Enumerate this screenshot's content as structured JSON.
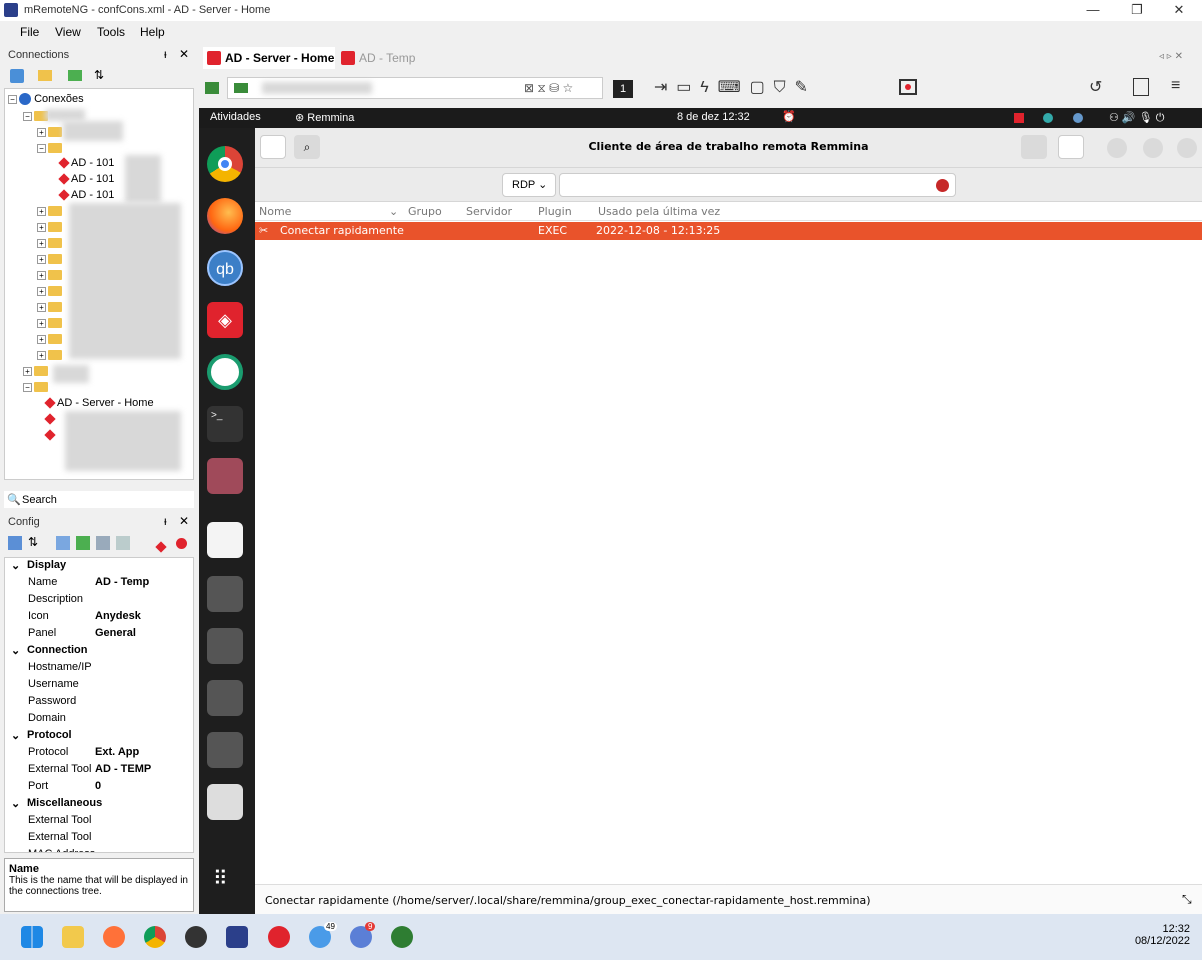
{
  "window": {
    "title": "mRemoteNG - confCons.xml - AD - Server - Home"
  },
  "menu": [
    "File",
    "View",
    "Tools",
    "Help"
  ],
  "connections_panel": {
    "title": "Connections",
    "root": "Conexões",
    "children": [
      "AD - 101",
      "AD - 101",
      "AD - 101"
    ],
    "selected": "AD - Server - Home",
    "search_label": "Search"
  },
  "config_panel": {
    "title": "Config",
    "categories": [
      {
        "name": "Display",
        "props": [
          {
            "k": "Name",
            "v": "AD - Temp"
          },
          {
            "k": "Description",
            "v": ""
          },
          {
            "k": "Icon",
            "v": "Anydesk"
          },
          {
            "k": "Panel",
            "v": "General"
          }
        ]
      },
      {
        "name": "Connection",
        "props": [
          {
            "k": "Hostname/IP",
            "v": ""
          },
          {
            "k": "Username",
            "v": ""
          },
          {
            "k": "Password",
            "v": ""
          },
          {
            "k": "Domain",
            "v": ""
          }
        ]
      },
      {
        "name": "Protocol",
        "props": [
          {
            "k": "Protocol",
            "v": "Ext. App"
          },
          {
            "k": "External Tool",
            "v": "AD - TEMP"
          },
          {
            "k": "Port",
            "v": "0"
          }
        ]
      },
      {
        "name": "Miscellaneous",
        "props": [
          {
            "k": "External Tool",
            "v": ""
          },
          {
            "k": "External Tool",
            "v": ""
          },
          {
            "k": "MAC Address",
            "v": ""
          }
        ]
      }
    ],
    "desc_title": "Name",
    "desc_text": "This is the name that will be displayed in the connections tree."
  },
  "tabs": [
    {
      "label": "AD - Server - Home",
      "active": true
    },
    {
      "label": "AD - Temp",
      "active": false
    }
  ],
  "ubuntu": {
    "activities": "Atividades",
    "app": "Remmina",
    "clock": "8 de dez  12:32"
  },
  "remmina": {
    "title": "Cliente de área de trabalho remota Remmina",
    "protocol": "RDP",
    "columns": [
      "Nome",
      "Grupo",
      "Servidor",
      "Plugin",
      "Usado pela última vez"
    ],
    "rows": [
      {
        "name": "Conectar rapidamente",
        "group": "",
        "server": "",
        "plugin": "EXEC",
        "last_used": "2022-12-08 - 12:13:25"
      }
    ],
    "status": "Conectar rapidamente (/home/server/.local/share/remmina/group_exec_conectar-rapidamente_host.remmina)"
  },
  "taskbar": {
    "time": "12:32",
    "date": "08/12/2022",
    "badge1": "49",
    "badge2": "9"
  },
  "colors": {
    "accent": "#e9532b",
    "dock": "#1e1e1e",
    "topbar": "#1b1b1b",
    "selection_red": "#e0232d"
  }
}
